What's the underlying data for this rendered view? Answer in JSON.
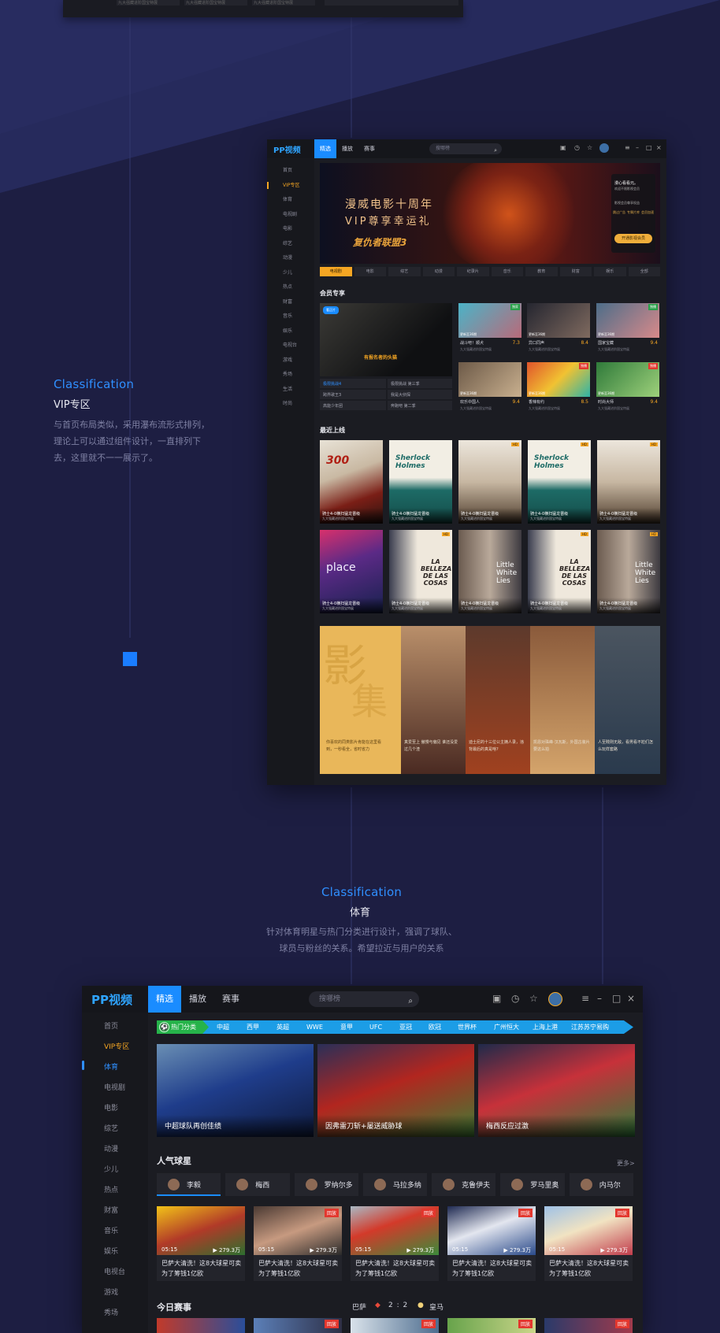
{
  "section1": {
    "eyebrow": "Classification",
    "title": "VIP专区",
    "desc": [
      "与首页布局类似，采用瀑布流形式排列，",
      "理论上可以通过组件设计，一直排列下",
      "去，这里就不一一展示了。"
    ]
  },
  "section2": {
    "eyebrow": "Classification",
    "title": "体育",
    "desc": [
      "针对体育明星与热门分类进行设计，强调了球队、",
      "球员与粉丝的关系。希望拉近与用户的关系"
    ]
  },
  "prev": {
    "cells": [
      "九大强藏进阶国宝特展",
      "九大强藏进阶国宝特展",
      "九大强藏进阶国宝特展"
    ]
  },
  "win1": {
    "logo": "PP视频",
    "tabs": [
      "精选",
      "播放",
      "赛事"
    ],
    "search_placeholder": "搜哪榜",
    "sidebar": [
      "首页",
      "VIP专区",
      "体育",
      "电视剧",
      "电影",
      "综艺",
      "动漫",
      "少儿",
      "热点",
      "财富",
      "音乐",
      "娱乐",
      "电视台",
      "游戏",
      "秀场",
      "生活",
      "时尚"
    ],
    "banner": {
      "line1": "漫威电影十周年",
      "line2": "VIP尊享幸运礼",
      "line3": "复仇者联盟3",
      "card_title": "漫心看看元。",
      "card_sub": "欢迎不限影视会员",
      "card_perks_title": "影视会员尊享权益",
      "perks": [
        "跳过广告",
        "专属片库",
        "会员加速"
      ],
      "cta": "开通影视会员"
    },
    "categories": [
      "电视剧",
      "电影",
      "综艺",
      "动漫",
      "纪录片",
      "音乐",
      "教育",
      "财富",
      "娱乐",
      "全部"
    ],
    "vip_heading": "会员专享",
    "featured": {
      "badge": "看正片",
      "subtitle": "有报名者的头猫"
    },
    "feature_links": [
      "极限挑战4",
      "极限挑战 第三季",
      "跨界歌王3",
      "我是大侦探",
      "高能少年团",
      "奔跑吧 第二季"
    ],
    "small_cards": [
      {
        "tag": "独家",
        "ttl": "战斗吧！顺犬",
        "score": "7.3",
        "ds": "九大强藏进阶国宝特展",
        "overlay": "更新至36期"
      },
      {
        "tag": "",
        "ttl": "异口同声",
        "score": "8.4",
        "ds": "九大强藏进阶国宝特展",
        "overlay": "更新至36期"
      },
      {
        "tag": "独播",
        "ttl": "国家宝藏",
        "score": "9.4",
        "ds": "九大强藏进阶国宝特展",
        "overlay": "更新至36期"
      },
      {
        "tag": "",
        "ttl": "欢乐中国人",
        "score": "9.4",
        "ds": "九大强藏进阶国宝特展",
        "overlay": "更新至36期"
      },
      {
        "tag": "独播",
        "ttl": "香辣有约",
        "score": "8.5",
        "ds": "九大强藏进阶国宝特展",
        "overlay": "更新至36期"
      },
      {
        "tag": "独播",
        "ttl": "时尚大师",
        "score": "9.4",
        "ds": "九大强藏进阶国宝特展",
        "overlay": "更新至36期"
      }
    ],
    "recent_heading": "最近上线",
    "posters": [
      {
        "title": "骑士4-0横扫猛龙晋级",
        "desc": "九大强藏进阶国宝特展",
        "hd": "",
        "art": "300"
      },
      {
        "title": "骑士4-0横扫猛龙晋级",
        "desc": "九大强藏进阶国宝特展",
        "hd": "",
        "art": "Sherlock Holmes"
      },
      {
        "title": "骑士4-0横扫猛龙晋级",
        "desc": "九大强藏进阶国宝特展",
        "hd": "HD",
        "art": ""
      },
      {
        "title": "骑士4-0横扫猛龙晋级",
        "desc": "九大强藏进阶国宝特展",
        "hd": "HD",
        "art": "Sherlock Holmes"
      },
      {
        "title": "骑士4-0横扫猛龙晋级",
        "desc": "九大强藏进阶国宝特展",
        "hd": "HD",
        "art": ""
      },
      {
        "title": "骑士4-0横扫猛龙晋级",
        "desc": "九大强藏进阶国宝特展",
        "hd": "",
        "art": "place"
      },
      {
        "title": "骑士4-0横扫猛龙晋级",
        "desc": "九大强藏进阶国宝特展",
        "hd": "HD",
        "art": "LA BELLEZA DE LAS COSAS"
      },
      {
        "title": "骑士4-0横扫猛龙晋级",
        "desc": "九大强藏进阶国宝特展",
        "hd": "",
        "art": "Little White Lies"
      },
      {
        "title": "骑士4-0横扫猛龙晋级",
        "desc": "九大强藏进阶国宝特展",
        "hd": "HD",
        "art": "LA BELLEZA DE LAS COSAS"
      },
      {
        "title": "骑士4-0横扫猛龙晋级",
        "desc": "九大强藏进阶国宝特展",
        "hd": "HD",
        "art": "Little White Lies"
      }
    ],
    "collage": {
      "big1": "影",
      "big2": "集",
      "descs": [
        "你喜欢的同类影片肯能在这里看到，一秒看全，省时省力",
        "真爱至上 傲慢与偏见 谁还没爱过几个渣",
        "迪士尼的十三位公主摘人录，违背最后的真是啥?",
        "凯恩对珠峰·汉瓦斯，外国古装片要这么拍",
        "人至贱则无敌，看男看不尬们怎么玩样套路"
      ]
    }
  },
  "win2": {
    "logo": "PP视频",
    "tabs": [
      "精选",
      "播放",
      "赛事"
    ],
    "search_placeholder": "搜哪榜",
    "sidebar": [
      "首页",
      "VIP专区",
      "体育",
      "电视剧",
      "电影",
      "综艺",
      "动漫",
      "少儿",
      "热点",
      "财富",
      "音乐",
      "娱乐",
      "电视台",
      "游戏",
      "秀场"
    ],
    "hot_label": "热门分类",
    "hot_items": [
      "中超",
      "西甲",
      "英超",
      "WWE",
      "意甲",
      "UFC",
      "亚冠",
      "欧冠",
      "世界杯",
      "广州恒大",
      "上海上港",
      "江苏苏宁易购"
    ],
    "heroes": [
      "中超球队再创佳绩",
      "因弗雷刀斩+屡送威胁球",
      "梅西反应过激"
    ],
    "stars_heading": "人气球星",
    "more": "更多>",
    "stars": [
      "李毅",
      "梅西",
      "罗纳尔多",
      "马拉多纳",
      "克鲁伊夫",
      "罗马里奥",
      "内马尔"
    ],
    "clips": [
      {
        "time": "05:15",
        "plays": "▶ 279.3万",
        "badge": "",
        "text": "巴萨大清洗！这8大球星可卖 为了筹钱1亿欧"
      },
      {
        "time": "05:15",
        "plays": "▶ 279.3万",
        "badge": "回放",
        "text": "巴萨大清洗！这8大球星可卖 为了筹钱1亿欧"
      },
      {
        "time": "05:15",
        "plays": "▶ 279.3万",
        "badge": "回放",
        "text": "巴萨大清洗！这8大球星可卖 为了筹钱1亿欧"
      },
      {
        "time": "05:15",
        "plays": "▶ 279.3万",
        "badge": "回放",
        "text": "巴萨大清洗！这8大球星可卖 为了筹钱1亿欧"
      },
      {
        "time": "05:15",
        "plays": "▶ 279.3万",
        "badge": "回放",
        "text": "巴萨大清洗！这8大球星可卖 为了筹钱1亿欧"
      }
    ],
    "today_heading": "今日赛事",
    "match": {
      "home": "巴萨",
      "score": "2 : 2",
      "away": "皇马"
    },
    "strip_badge": "回放"
  }
}
